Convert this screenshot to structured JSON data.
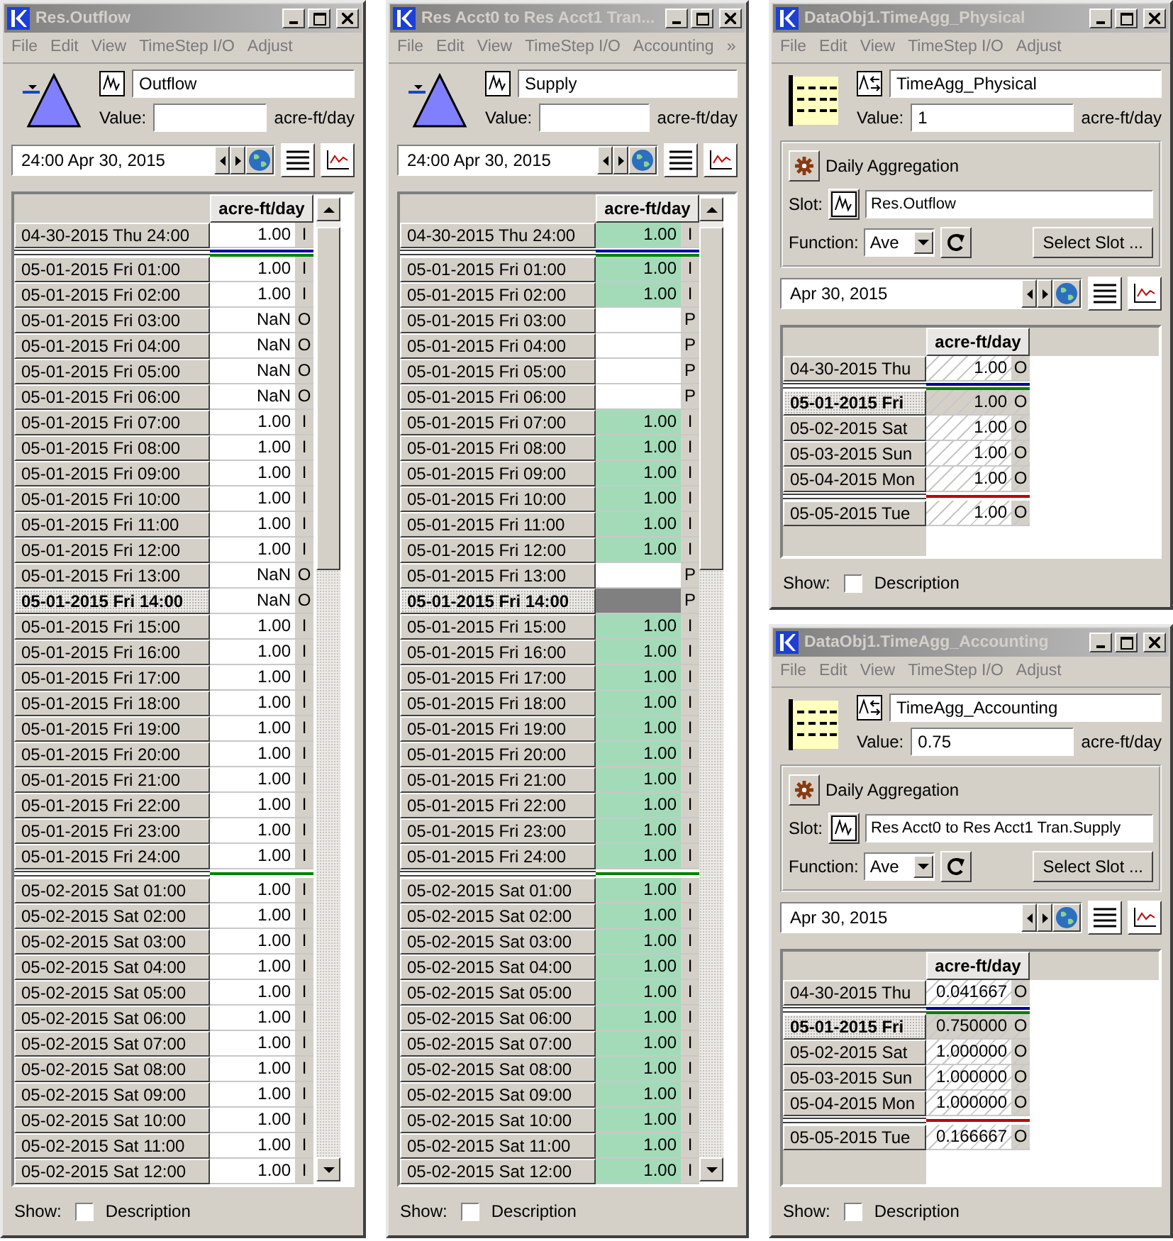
{
  "windows": [
    {
      "kind": "slot",
      "title": "Res.Outflow",
      "menu": [
        "File",
        "Edit",
        "View",
        "TimeStep I/O",
        "Adjust"
      ],
      "slot_name": "Outflow",
      "value_label": "Value:",
      "unit": "acre-ft/day",
      "date": "24:00 Apr 30, 2015",
      "table": {
        "column": "acre-ft/day",
        "rows": [
          {
            "kind": "row",
            "date": "04-30-2015 Thu 24:00",
            "value": "1.00",
            "flag": "I",
            "selected": false
          },
          {
            "kind": "divider",
            "lines": [
              {
                "color": "#0000a0"
              },
              {
                "color": "#008000"
              }
            ]
          },
          {
            "kind": "row",
            "date": "05-01-2015 Fri 01:00",
            "value": "1.00",
            "flag": "I",
            "selected": false
          },
          {
            "kind": "row",
            "date": "05-01-2015 Fri 02:00",
            "value": "1.00",
            "flag": "I",
            "selected": false
          },
          {
            "kind": "row",
            "date": "05-01-2015 Fri 03:00",
            "value": "NaN",
            "flag": "O",
            "selected": false
          },
          {
            "kind": "row",
            "date": "05-01-2015 Fri 04:00",
            "value": "NaN",
            "flag": "O",
            "selected": false
          },
          {
            "kind": "row",
            "date": "05-01-2015 Fri 05:00",
            "value": "NaN",
            "flag": "O",
            "selected": false
          },
          {
            "kind": "row",
            "date": "05-01-2015 Fri 06:00",
            "value": "NaN",
            "flag": "O",
            "selected": false
          },
          {
            "kind": "row",
            "date": "05-01-2015 Fri 07:00",
            "value": "1.00",
            "flag": "I",
            "selected": false
          },
          {
            "kind": "row",
            "date": "05-01-2015 Fri 08:00",
            "value": "1.00",
            "flag": "I",
            "selected": false
          },
          {
            "kind": "row",
            "date": "05-01-2015 Fri 09:00",
            "value": "1.00",
            "flag": "I",
            "selected": false
          },
          {
            "kind": "row",
            "date": "05-01-2015 Fri 10:00",
            "value": "1.00",
            "flag": "I",
            "selected": false
          },
          {
            "kind": "row",
            "date": "05-01-2015 Fri 11:00",
            "value": "1.00",
            "flag": "I",
            "selected": false
          },
          {
            "kind": "row",
            "date": "05-01-2015 Fri 12:00",
            "value": "1.00",
            "flag": "I",
            "selected": false
          },
          {
            "kind": "row",
            "date": "05-01-2015 Fri 13:00",
            "value": "NaN",
            "flag": "O",
            "selected": false
          },
          {
            "kind": "row",
            "date": "05-01-2015 Fri 14:00",
            "value": "NaN",
            "flag": "O",
            "selected": true
          },
          {
            "kind": "row",
            "date": "05-01-2015 Fri 15:00",
            "value": "1.00",
            "flag": "I",
            "selected": false
          },
          {
            "kind": "row",
            "date": "05-01-2015 Fri 16:00",
            "value": "1.00",
            "flag": "I",
            "selected": false
          },
          {
            "kind": "row",
            "date": "05-01-2015 Fri 17:00",
            "value": "1.00",
            "flag": "I",
            "selected": false
          },
          {
            "kind": "row",
            "date": "05-01-2015 Fri 18:00",
            "value": "1.00",
            "flag": "I",
            "selected": false
          },
          {
            "kind": "row",
            "date": "05-01-2015 Fri 19:00",
            "value": "1.00",
            "flag": "I",
            "selected": false
          },
          {
            "kind": "row",
            "date": "05-01-2015 Fri 20:00",
            "value": "1.00",
            "flag": "I",
            "selected": false
          },
          {
            "kind": "row",
            "date": "05-01-2015 Fri 21:00",
            "value": "1.00",
            "flag": "I",
            "selected": false
          },
          {
            "kind": "row",
            "date": "05-01-2015 Fri 22:00",
            "value": "1.00",
            "flag": "I",
            "selected": false
          },
          {
            "kind": "row",
            "date": "05-01-2015 Fri 23:00",
            "value": "1.00",
            "flag": "I",
            "selected": false
          },
          {
            "kind": "row",
            "date": "05-01-2015 Fri 24:00",
            "value": "1.00",
            "flag": "I",
            "selected": false
          },
          {
            "kind": "divider",
            "lines": [
              {
                "color": "#008000"
              }
            ]
          },
          {
            "kind": "row",
            "date": "05-02-2015 Sat 01:00",
            "value": "1.00",
            "flag": "I",
            "selected": false
          },
          {
            "kind": "row",
            "date": "05-02-2015 Sat 02:00",
            "value": "1.00",
            "flag": "I",
            "selected": false
          },
          {
            "kind": "row",
            "date": "05-02-2015 Sat 03:00",
            "value": "1.00",
            "flag": "I",
            "selected": false
          },
          {
            "kind": "row",
            "date": "05-02-2015 Sat 04:00",
            "value": "1.00",
            "flag": "I",
            "selected": false
          },
          {
            "kind": "row",
            "date": "05-02-2015 Sat 05:00",
            "value": "1.00",
            "flag": "I",
            "selected": false
          },
          {
            "kind": "row",
            "date": "05-02-2015 Sat 06:00",
            "value": "1.00",
            "flag": "I",
            "selected": false
          },
          {
            "kind": "row",
            "date": "05-02-2015 Sat 07:00",
            "value": "1.00",
            "flag": "I",
            "selected": false
          },
          {
            "kind": "row",
            "date": "05-02-2015 Sat 08:00",
            "value": "1.00",
            "flag": "I",
            "selected": false
          },
          {
            "kind": "row",
            "date": "05-02-2015 Sat 09:00",
            "value": "1.00",
            "flag": "I",
            "selected": false
          },
          {
            "kind": "row",
            "date": "05-02-2015 Sat 10:00",
            "value": "1.00",
            "flag": "I",
            "selected": false
          },
          {
            "kind": "row",
            "date": "05-02-2015 Sat 11:00",
            "value": "1.00",
            "flag": "I",
            "selected": false
          },
          {
            "kind": "row",
            "date": "05-02-2015 Sat 12:00",
            "value": "1.00",
            "flag": "I",
            "selected": false
          }
        ]
      },
      "show": {
        "label": "Show:",
        "option": "Description",
        "checked": false
      }
    },
    {
      "kind": "slot",
      "title": "Res Acct0 to Res Acct1 Tran...",
      "menu": [
        "File",
        "Edit",
        "View",
        "TimeStep I/O",
        "Accounting",
        "»"
      ],
      "slot_name": "Supply",
      "value_label": "Value:",
      "unit": "acre-ft/day",
      "date": "24:00 Apr 30, 2015",
      "table": {
        "column": "acre-ft/day",
        "rows": [
          {
            "kind": "row",
            "date": "04-30-2015 Thu 24:00",
            "value": "1.00",
            "flag": "I",
            "selected": false,
            "color": "#a3dbb9"
          },
          {
            "kind": "divider",
            "lines": [
              {
                "color": "#0000a0"
              },
              {
                "color": "#008000"
              }
            ]
          },
          {
            "kind": "row",
            "date": "05-01-2015 Fri 01:00",
            "value": "1.00",
            "flag": "I",
            "selected": false,
            "color": "#a3dbb9"
          },
          {
            "kind": "row",
            "date": "05-01-2015 Fri 02:00",
            "value": "1.00",
            "flag": "I",
            "selected": false,
            "color": "#a3dbb9"
          },
          {
            "kind": "row",
            "date": "05-01-2015 Fri 03:00",
            "flag": "P",
            "selected": false,
            "color": "#ffffff"
          },
          {
            "kind": "row",
            "date": "05-01-2015 Fri 04:00",
            "flag": "P",
            "selected": false,
            "color": "#ffffff"
          },
          {
            "kind": "row",
            "date": "05-01-2015 Fri 05:00",
            "flag": "P",
            "selected": false,
            "color": "#ffffff"
          },
          {
            "kind": "row",
            "date": "05-01-2015 Fri 06:00",
            "flag": "P",
            "selected": false,
            "color": "#ffffff"
          },
          {
            "kind": "row",
            "date": "05-01-2015 Fri 07:00",
            "value": "1.00",
            "flag": "I",
            "selected": false,
            "color": "#a3dbb9"
          },
          {
            "kind": "row",
            "date": "05-01-2015 Fri 08:00",
            "value": "1.00",
            "flag": "I",
            "selected": false,
            "color": "#a3dbb9"
          },
          {
            "kind": "row",
            "date": "05-01-2015 Fri 09:00",
            "value": "1.00",
            "flag": "I",
            "selected": false,
            "color": "#a3dbb9"
          },
          {
            "kind": "row",
            "date": "05-01-2015 Fri 10:00",
            "value": "1.00",
            "flag": "I",
            "selected": false,
            "color": "#a3dbb9"
          },
          {
            "kind": "row",
            "date": "05-01-2015 Fri 11:00",
            "value": "1.00",
            "flag": "I",
            "selected": false,
            "color": "#a3dbb9"
          },
          {
            "kind": "row",
            "date": "05-01-2015 Fri 12:00",
            "value": "1.00",
            "flag": "I",
            "selected": false,
            "color": "#a3dbb9"
          },
          {
            "kind": "row",
            "date": "05-01-2015 Fri 13:00",
            "flag": "P",
            "selected": false,
            "color": "#ffffff"
          },
          {
            "kind": "row",
            "date": "05-01-2015 Fri 14:00",
            "flag": "P",
            "selected": true,
            "color": "#808080"
          },
          {
            "kind": "row",
            "date": "05-01-2015 Fri 15:00",
            "value": "1.00",
            "flag": "I",
            "selected": false,
            "color": "#a3dbb9"
          },
          {
            "kind": "row",
            "date": "05-01-2015 Fri 16:00",
            "value": "1.00",
            "flag": "I",
            "selected": false,
            "color": "#a3dbb9"
          },
          {
            "kind": "row",
            "date": "05-01-2015 Fri 17:00",
            "value": "1.00",
            "flag": "I",
            "selected": false,
            "color": "#a3dbb9"
          },
          {
            "kind": "row",
            "date": "05-01-2015 Fri 18:00",
            "value": "1.00",
            "flag": "I",
            "selected": false,
            "color": "#a3dbb9"
          },
          {
            "kind": "row",
            "date": "05-01-2015 Fri 19:00",
            "value": "1.00",
            "flag": "I",
            "selected": false,
            "color": "#a3dbb9"
          },
          {
            "kind": "row",
            "date": "05-01-2015 Fri 20:00",
            "value": "1.00",
            "flag": "I",
            "selected": false,
            "color": "#a3dbb9"
          },
          {
            "kind": "row",
            "date": "05-01-2015 Fri 21:00",
            "value": "1.00",
            "flag": "I",
            "selected": false,
            "color": "#a3dbb9"
          },
          {
            "kind": "row",
            "date": "05-01-2015 Fri 22:00",
            "value": "1.00",
            "flag": "I",
            "selected": false,
            "color": "#a3dbb9"
          },
          {
            "kind": "row",
            "date": "05-01-2015 Fri 23:00",
            "value": "1.00",
            "flag": "I",
            "selected": false,
            "color": "#a3dbb9"
          },
          {
            "kind": "row",
            "date": "05-01-2015 Fri 24:00",
            "value": "1.00",
            "flag": "I",
            "selected": false,
            "color": "#a3dbb9"
          },
          {
            "kind": "divider",
            "lines": [
              {
                "color": "#008000"
              }
            ]
          },
          {
            "kind": "row",
            "date": "05-02-2015 Sat 01:00",
            "value": "1.00",
            "flag": "I",
            "selected": false,
            "color": "#a3dbb9"
          },
          {
            "kind": "row",
            "date": "05-02-2015 Sat 02:00",
            "value": "1.00",
            "flag": "I",
            "selected": false,
            "color": "#a3dbb9"
          },
          {
            "kind": "row",
            "date": "05-02-2015 Sat 03:00",
            "value": "1.00",
            "flag": "I",
            "selected": false,
            "color": "#a3dbb9"
          },
          {
            "kind": "row",
            "date": "05-02-2015 Sat 04:00",
            "value": "1.00",
            "flag": "I",
            "selected": false,
            "color": "#a3dbb9"
          },
          {
            "kind": "row",
            "date": "05-02-2015 Sat 05:00",
            "value": "1.00",
            "flag": "I",
            "selected": false,
            "color": "#a3dbb9"
          },
          {
            "kind": "row",
            "date": "05-02-2015 Sat 06:00",
            "value": "1.00",
            "flag": "I",
            "selected": false,
            "color": "#a3dbb9"
          },
          {
            "kind": "row",
            "date": "05-02-2015 Sat 07:00",
            "value": "1.00",
            "flag": "I",
            "selected": false,
            "color": "#a3dbb9"
          },
          {
            "kind": "row",
            "date": "05-02-2015 Sat 08:00",
            "value": "1.00",
            "flag": "I",
            "selected": false,
            "color": "#a3dbb9"
          },
          {
            "kind": "row",
            "date": "05-02-2015 Sat 09:00",
            "value": "1.00",
            "flag": "I",
            "selected": false,
            "color": "#a3dbb9"
          },
          {
            "kind": "row",
            "date": "05-02-2015 Sat 10:00",
            "value": "1.00",
            "flag": "I",
            "selected": false,
            "color": "#a3dbb9"
          },
          {
            "kind": "row",
            "date": "05-02-2015 Sat 11:00",
            "value": "1.00",
            "flag": "I",
            "selected": false,
            "color": "#a3dbb9"
          },
          {
            "kind": "row",
            "date": "05-02-2015 Sat 12:00",
            "value": "1.00",
            "flag": "I",
            "selected": false,
            "color": "#a3dbb9"
          }
        ]
      },
      "show": {
        "label": "Show:",
        "option": "Description",
        "checked": false
      }
    },
    {
      "kind": "aggregation",
      "title": "DataObj1.TimeAgg_Physical",
      "menu": [
        "File",
        "Edit",
        "View",
        "TimeStep I/O",
        "Adjust"
      ],
      "slot_name": "TimeAgg_Physical",
      "value_label": "Value:",
      "value": "1",
      "unit": "acre-ft/day",
      "aggregation": {
        "title": "Daily Aggregation",
        "slot_label": "Slot:",
        "slot": "Res.Outflow",
        "function_label": "Function:",
        "function": "Ave",
        "select_button": "Select Slot ..."
      },
      "date": "Apr 30, 2015",
      "table": {
        "column": "acre-ft/day",
        "rows": [
          {
            "kind": "row",
            "date": "04-30-2015 Thu",
            "value": "1.00",
            "flag": "O",
            "selected": false
          },
          {
            "kind": "divider",
            "lines": [
              {
                "color": "#0000a0"
              },
              {
                "color": "#008000"
              }
            ]
          },
          {
            "kind": "row",
            "date": "05-01-2015 Fri",
            "value": "1.00",
            "flag": "O",
            "selected": true
          },
          {
            "kind": "row",
            "date": "05-02-2015 Sat",
            "value": "1.00",
            "flag": "O",
            "selected": false
          },
          {
            "kind": "row",
            "date": "05-03-2015 Sun",
            "value": "1.00",
            "flag": "O",
            "selected": false
          },
          {
            "kind": "row",
            "date": "05-04-2015 Mon",
            "value": "1.00",
            "flag": "O",
            "selected": false
          },
          {
            "kind": "divider",
            "lines": [
              {
                "color": "#c00000"
              }
            ]
          },
          {
            "kind": "row",
            "date": "05-05-2015 Tue",
            "value": "1.00",
            "flag": "O",
            "selected": false
          }
        ]
      },
      "show": {
        "label": "Show:",
        "option": "Description",
        "checked": false
      }
    },
    {
      "kind": "aggregation",
      "title": "DataObj1.TimeAgg_Accounting",
      "menu": [
        "File",
        "Edit",
        "View",
        "TimeStep I/O",
        "Adjust"
      ],
      "slot_name": "TimeAgg_Accounting",
      "value_label": "Value:",
      "value": "0.75",
      "unit": "acre-ft/day",
      "aggregation": {
        "title": "Daily Aggregation",
        "slot_label": "Slot:",
        "slot": "Res Acct0 to Res Acct1 Tran.Supply",
        "function_label": "Function:",
        "function": "Ave",
        "select_button": "Select Slot ..."
      },
      "date": "Apr 30, 2015",
      "table": {
        "column": "acre-ft/day",
        "rows": [
          {
            "kind": "row",
            "date": "04-30-2015 Thu",
            "value": "0.041667",
            "flag": "O",
            "selected": false
          },
          {
            "kind": "divider",
            "lines": [
              {
                "color": "#0000a0"
              },
              {
                "color": "#008000"
              }
            ]
          },
          {
            "kind": "row",
            "date": "05-01-2015 Fri",
            "value": "0.750000",
            "flag": "O",
            "selected": true
          },
          {
            "kind": "row",
            "date": "05-02-2015 Sat",
            "value": "1.000000",
            "flag": "O",
            "selected": false
          },
          {
            "kind": "row",
            "date": "05-03-2015 Sun",
            "value": "1.000000",
            "flag": "O",
            "selected": false
          },
          {
            "kind": "row",
            "date": "05-04-2015 Mon",
            "value": "1.000000",
            "flag": "O",
            "selected": false
          },
          {
            "kind": "divider",
            "lines": [
              {
                "color": "#c00000"
              }
            ]
          },
          {
            "kind": "row",
            "date": "05-05-2015 Tue",
            "value": "0.166667",
            "flag": "O",
            "selected": false
          }
        ]
      },
      "show": {
        "label": "Show:",
        "option": "Description",
        "checked": false
      }
    }
  ]
}
